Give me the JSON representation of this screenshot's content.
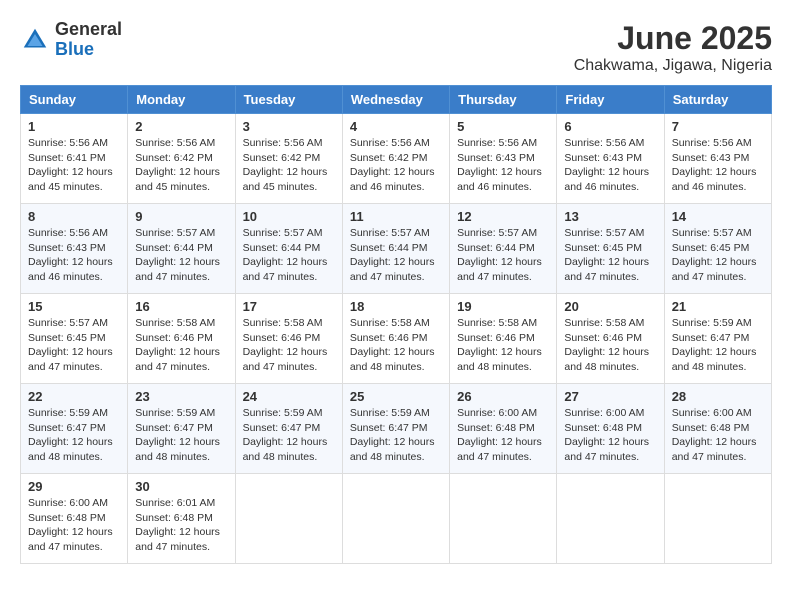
{
  "logo": {
    "general": "General",
    "blue": "Blue"
  },
  "title": "June 2025",
  "location": "Chakwama, Jigawa, Nigeria",
  "weekdays": [
    "Sunday",
    "Monday",
    "Tuesday",
    "Wednesday",
    "Thursday",
    "Friday",
    "Saturday"
  ],
  "weeks": [
    [
      {
        "day": "1",
        "sunrise": "5:56 AM",
        "sunset": "6:41 PM",
        "daylight": "12 hours and 45 minutes."
      },
      {
        "day": "2",
        "sunrise": "5:56 AM",
        "sunset": "6:42 PM",
        "daylight": "12 hours and 45 minutes."
      },
      {
        "day": "3",
        "sunrise": "5:56 AM",
        "sunset": "6:42 PM",
        "daylight": "12 hours and 45 minutes."
      },
      {
        "day": "4",
        "sunrise": "5:56 AM",
        "sunset": "6:42 PM",
        "daylight": "12 hours and 46 minutes."
      },
      {
        "day": "5",
        "sunrise": "5:56 AM",
        "sunset": "6:43 PM",
        "daylight": "12 hours and 46 minutes."
      },
      {
        "day": "6",
        "sunrise": "5:56 AM",
        "sunset": "6:43 PM",
        "daylight": "12 hours and 46 minutes."
      },
      {
        "day": "7",
        "sunrise": "5:56 AM",
        "sunset": "6:43 PM",
        "daylight": "12 hours and 46 minutes."
      }
    ],
    [
      {
        "day": "8",
        "sunrise": "5:56 AM",
        "sunset": "6:43 PM",
        "daylight": "12 hours and 46 minutes."
      },
      {
        "day": "9",
        "sunrise": "5:57 AM",
        "sunset": "6:44 PM",
        "daylight": "12 hours and 47 minutes."
      },
      {
        "day": "10",
        "sunrise": "5:57 AM",
        "sunset": "6:44 PM",
        "daylight": "12 hours and 47 minutes."
      },
      {
        "day": "11",
        "sunrise": "5:57 AM",
        "sunset": "6:44 PM",
        "daylight": "12 hours and 47 minutes."
      },
      {
        "day": "12",
        "sunrise": "5:57 AM",
        "sunset": "6:44 PM",
        "daylight": "12 hours and 47 minutes."
      },
      {
        "day": "13",
        "sunrise": "5:57 AM",
        "sunset": "6:45 PM",
        "daylight": "12 hours and 47 minutes."
      },
      {
        "day": "14",
        "sunrise": "5:57 AM",
        "sunset": "6:45 PM",
        "daylight": "12 hours and 47 minutes."
      }
    ],
    [
      {
        "day": "15",
        "sunrise": "5:57 AM",
        "sunset": "6:45 PM",
        "daylight": "12 hours and 47 minutes."
      },
      {
        "day": "16",
        "sunrise": "5:58 AM",
        "sunset": "6:46 PM",
        "daylight": "12 hours and 47 minutes."
      },
      {
        "day": "17",
        "sunrise": "5:58 AM",
        "sunset": "6:46 PM",
        "daylight": "12 hours and 47 minutes."
      },
      {
        "day": "18",
        "sunrise": "5:58 AM",
        "sunset": "6:46 PM",
        "daylight": "12 hours and 48 minutes."
      },
      {
        "day": "19",
        "sunrise": "5:58 AM",
        "sunset": "6:46 PM",
        "daylight": "12 hours and 48 minutes."
      },
      {
        "day": "20",
        "sunrise": "5:58 AM",
        "sunset": "6:46 PM",
        "daylight": "12 hours and 48 minutes."
      },
      {
        "day": "21",
        "sunrise": "5:59 AM",
        "sunset": "6:47 PM",
        "daylight": "12 hours and 48 minutes."
      }
    ],
    [
      {
        "day": "22",
        "sunrise": "5:59 AM",
        "sunset": "6:47 PM",
        "daylight": "12 hours and 48 minutes."
      },
      {
        "day": "23",
        "sunrise": "5:59 AM",
        "sunset": "6:47 PM",
        "daylight": "12 hours and 48 minutes."
      },
      {
        "day": "24",
        "sunrise": "5:59 AM",
        "sunset": "6:47 PM",
        "daylight": "12 hours and 48 minutes."
      },
      {
        "day": "25",
        "sunrise": "5:59 AM",
        "sunset": "6:47 PM",
        "daylight": "12 hours and 48 minutes."
      },
      {
        "day": "26",
        "sunrise": "6:00 AM",
        "sunset": "6:48 PM",
        "daylight": "12 hours and 47 minutes."
      },
      {
        "day": "27",
        "sunrise": "6:00 AM",
        "sunset": "6:48 PM",
        "daylight": "12 hours and 47 minutes."
      },
      {
        "day": "28",
        "sunrise": "6:00 AM",
        "sunset": "6:48 PM",
        "daylight": "12 hours and 47 minutes."
      }
    ],
    [
      {
        "day": "29",
        "sunrise": "6:00 AM",
        "sunset": "6:48 PM",
        "daylight": "12 hours and 47 minutes."
      },
      {
        "day": "30",
        "sunrise": "6:01 AM",
        "sunset": "6:48 PM",
        "daylight": "12 hours and 47 minutes."
      },
      null,
      null,
      null,
      null,
      null
    ]
  ]
}
